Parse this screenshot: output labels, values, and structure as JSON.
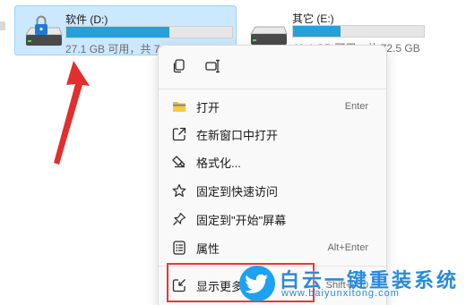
{
  "drives": [
    {
      "name": "软件 (D:)",
      "stats": "27.1 GB 可用，共 71.9 GB",
      "used_fraction": 0.62,
      "selected": true,
      "icon": "drive-lock-icon"
    },
    {
      "name": "其它 (E:)",
      "stats": "46.4 GB 可用，共 72.5 GB",
      "used_fraction": 0.36,
      "selected": false,
      "icon": "drive-icon"
    }
  ],
  "context_menu": {
    "quick_actions": [
      {
        "icon": "copy-icon"
      },
      {
        "icon": "rename-icon"
      }
    ],
    "items": [
      {
        "label": "打开",
        "shortcut": "Enter",
        "icon": "folder-open-icon"
      },
      {
        "label": "在新窗口中打开",
        "shortcut": "",
        "icon": "open-new-window-icon"
      },
      {
        "label": "格式化...",
        "shortcut": "",
        "icon": "format-drive-icon"
      },
      {
        "label": "固定到快速访问",
        "shortcut": "",
        "icon": "star-icon"
      },
      {
        "label": "固定到\"开始\"屏幕",
        "shortcut": "",
        "icon": "pin-icon"
      },
      {
        "label": "属性",
        "shortcut": "Alt+Enter",
        "icon": "properties-icon"
      },
      {
        "label": "显示更多选项",
        "shortcut": "Shift+F10",
        "icon": "show-more-icon"
      }
    ]
  },
  "watermark": {
    "title": "白云一键重装系统",
    "url": "www.baiyunxitong.com"
  },
  "colors": {
    "selection_bg": "#cce8ff",
    "bar_fill": "#26a0da",
    "highlight": "#e53935",
    "watermark": "#2a8ad8"
  }
}
